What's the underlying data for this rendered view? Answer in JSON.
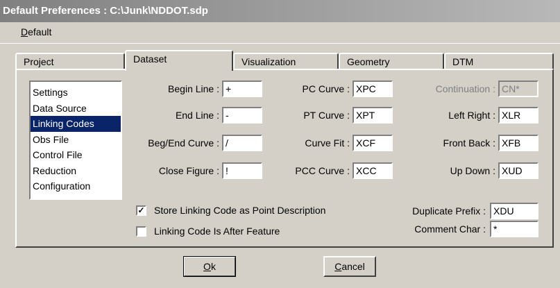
{
  "window": {
    "title": "Default Preferences : C:\\Junk\\NDDOT.sdp"
  },
  "menu": {
    "default_label": "Default",
    "default_accel": "D",
    "default_rest": "efault"
  },
  "tabs": [
    {
      "label": "Project"
    },
    {
      "label": "Dataset"
    },
    {
      "label": "Visualization"
    },
    {
      "label": "Geometry"
    },
    {
      "label": "DTM"
    }
  ],
  "active_tab": "Dataset",
  "sidebar": {
    "items": [
      {
        "label": "Settings"
      },
      {
        "label": "Data Source"
      },
      {
        "label": "Linking Codes"
      },
      {
        "label": "Obs File"
      },
      {
        "label": "Control File"
      },
      {
        "label": "Reduction"
      },
      {
        "label": "Configuration"
      }
    ],
    "selected": "Linking Codes"
  },
  "fields": {
    "begin_line": {
      "label": "Begin Line :",
      "value": "+"
    },
    "end_line": {
      "label": "End Line :",
      "value": "-"
    },
    "beg_end_curve": {
      "label": "Beg/End Curve :",
      "value": "/"
    },
    "close_figure": {
      "label": "Close Figure :",
      "value": "!"
    },
    "pc_curve": {
      "label": "PC Curve :",
      "value": "XPC"
    },
    "pt_curve": {
      "label": "PT Curve :",
      "value": "XPT"
    },
    "curve_fit": {
      "label": "Curve Fit :",
      "value": "XCF"
    },
    "pcc_curve": {
      "label": "PCC Curve :",
      "value": "XCC"
    },
    "continuation": {
      "label": "Continuation :",
      "value": "CN*",
      "disabled": true
    },
    "left_right": {
      "label": "Left Right :",
      "value": "XLR"
    },
    "front_back": {
      "label": "Front Back :",
      "value": "XFB"
    },
    "up_down": {
      "label": "Up Down :",
      "value": "XUD"
    },
    "duplicate_prefix": {
      "label": "Duplicate Prefix :",
      "value": "XDU"
    },
    "comment_char": {
      "label": "Comment Char :",
      "value": "*"
    }
  },
  "checkboxes": {
    "store_linking_code": {
      "label": "Store Linking Code as Point Description",
      "checked": true,
      "mark": "✓"
    },
    "linking_code_after": {
      "label": "Linking Code Is After Feature",
      "checked": false,
      "mark": ""
    }
  },
  "buttons": {
    "ok": {
      "label": "Ok",
      "accel": "O",
      "rest": "k"
    },
    "cancel": {
      "label": "Cancel",
      "accel": "C",
      "rest": "ancel"
    }
  }
}
